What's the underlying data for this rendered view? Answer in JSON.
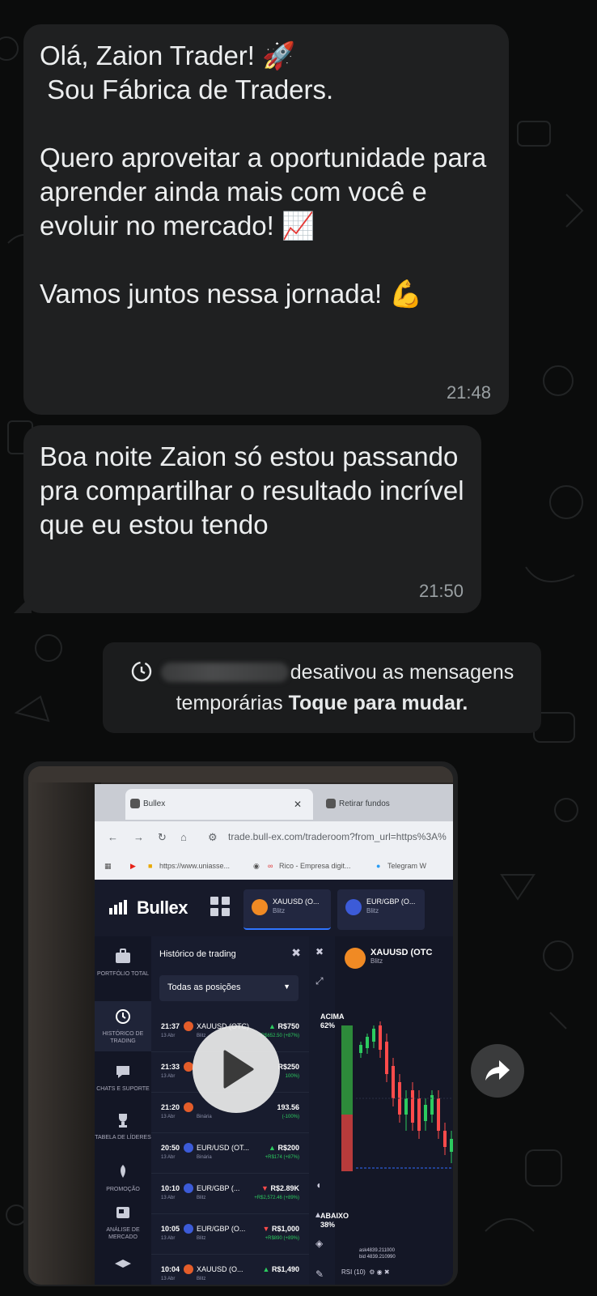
{
  "messages": [
    {
      "text": "Olá, Zaion Trader! 🚀\n Sou Fábrica de Traders.\n\nQuero aproveitar a oportunidade para aprender ainda mais com você e evoluir no mercado! 📈\n\nVamos juntos nessa jornada! 💪",
      "time": "21:48"
    },
    {
      "text": "Boa noite Zaion só estou passando pra compartilhar o resultado incrível que eu estou tendo",
      "time": "21:50"
    }
  ],
  "system_notice": {
    "text_before": "desativou as mensagens temporárias ",
    "action": "Toque para mudar."
  },
  "screenshot": {
    "tabs": [
      "Bullex",
      "Retirar fundos"
    ],
    "address": "trade.bull-ex.com/traderoom?from_url=https%3A%",
    "bookmarks": [
      "https://www.uniasse...",
      "Rico - Empresa digit...",
      "Telegram W"
    ],
    "brand": "Bullex",
    "asset_tabs": [
      {
        "name": "XAUUSD (O...",
        "type": "Blitz"
      },
      {
        "name": "EUR/GBP (O...",
        "type": "Blitz"
      }
    ],
    "sidebar": [
      "PORTFÓLIO TOTAL",
      "HISTÓRICO DE TRADING",
      "CHATS E SUPORTE",
      "TABELA DE LÍDERES",
      "PROMOÇÃO",
      "ANÁLISE DE MERCADO"
    ],
    "panel_title": "Histórico de trading",
    "filter": "Todas as posições",
    "trades": [
      {
        "time": "21:37",
        "date": "13 Abr",
        "asset": "XAUUSD (OTC)",
        "kind": "Blitz",
        "dir": "▲",
        "amount": "R$750",
        "profit": "+R$652.50 (+87%)"
      },
      {
        "time": "21:33",
        "date": "13 Abr",
        "asset": "",
        "kind": "",
        "dir": "",
        "amount": "R$250",
        "profit": "100%)"
      },
      {
        "time": "21:20",
        "date": "13 Abr",
        "asset": "",
        "kind": "Binária",
        "dir": "",
        "amount": "193.56",
        "profit": "(-100%)"
      },
      {
        "time": "20:50",
        "date": "13 Abr",
        "asset": "EUR/USD (OT...",
        "kind": "Binária",
        "dir": "▲",
        "amount": "R$200",
        "profit": "+R$174 (+87%)"
      },
      {
        "time": "10:10",
        "date": "13 Abr",
        "asset": "EUR/GBP (...",
        "kind": "Blitz",
        "dir": "▼",
        "amount": "R$2.89K",
        "profit": "+R$2,572.46 (+89%)"
      },
      {
        "time": "10:05",
        "date": "13 Abr",
        "asset": "EUR/GBP (O...",
        "kind": "Blitz",
        "dir": "▼",
        "amount": "R$1,000",
        "profit": "+R$890 (+89%)"
      },
      {
        "time": "10:04",
        "date": "13 Abr",
        "asset": "XAUUSD (O...",
        "kind": "Blitz",
        "dir": "▲",
        "amount": "R$1,490",
        "profit": ""
      }
    ],
    "chart_asset": "XAUUSD (OTC",
    "chart_asset_type": "Blitz",
    "above_label": "ACIMA",
    "above_pct": "62%",
    "below_label": "ABAIXO",
    "below_pct": "38%",
    "ask": "ask4839.211000",
    "bid": "bid 4839.210990",
    "indicator": "RSI (10)"
  }
}
